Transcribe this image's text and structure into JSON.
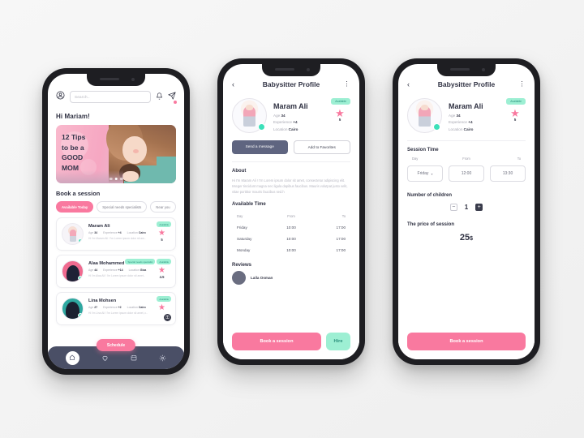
{
  "colors": {
    "pink": "#f9799f",
    "mint": "#9defd3",
    "navy": "#4a4f66",
    "bg": "#f4f4f4"
  },
  "home": {
    "search_placeholder": "Search..",
    "icons": {
      "profile": "profile-icon",
      "bell": "bell-icon",
      "send": "send-icon"
    },
    "greeting": "Hi Mariam!",
    "banner": {
      "line1": "12 Tips",
      "line2": "to be a",
      "line3": "GOOD",
      "line4": "MOM"
    },
    "section_title": "Book a session",
    "chips": [
      {
        "label": "Available Today",
        "active": true
      },
      {
        "label": "Special needs specialists",
        "active": false
      },
      {
        "label": "Near you",
        "active": false
      }
    ],
    "cards": [
      {
        "name": "Maram Ali",
        "age_label": "Age",
        "age": "34",
        "exp_label": "Experience",
        "exp": "+4",
        "loc_label": "Location",
        "loc": "Cairo",
        "bio": "Hi I'm Maram Ali ! I'm Lorem ipsum dolor sit am..",
        "rating": "5",
        "badges": [
          "Available"
        ]
      },
      {
        "name": "Alaa Mohammed",
        "age_label": "Age",
        "age": "44",
        "exp_label": "Experience",
        "exp": "+14",
        "loc_label": "Location",
        "loc": "Giza",
        "bio": "Hi I'm Alaa Ali ! I'm Lorem ipsum dolor sit amet..",
        "rating": "4.5",
        "badges": [
          "Special needs specialist",
          "Available"
        ]
      },
      {
        "name": "Lina Mohsen",
        "age_label": "Age",
        "age": "27",
        "exp_label": "Experience",
        "exp": "+2",
        "loc_label": "Location",
        "loc": "Cairo",
        "bio": "Hi I'm Lina Ali ! I'm Lorem ipsum dolor sit amet, c..",
        "rating": "",
        "badges": [
          "Available"
        ],
        "locked": "⚿"
      }
    ],
    "schedule_label": "Schedule",
    "nav": [
      {
        "name": "home",
        "glyph": "⌂",
        "active": true
      },
      {
        "name": "favorites",
        "glyph": "♡",
        "active": false
      },
      {
        "name": "calendar",
        "glyph": "☷",
        "active": false
      },
      {
        "name": "settings",
        "glyph": "⚙",
        "active": false
      }
    ]
  },
  "profile": {
    "title": "Babysitter Profile",
    "sitter": {
      "name": "Maram Ali",
      "age_label": "Age",
      "age": "34",
      "exp_label": "Experience",
      "exp": "+4",
      "loc_label": "Location",
      "loc": "Cairo",
      "rating": "5",
      "badge": "Available"
    },
    "actions": {
      "message": "Send a message",
      "favorite": "Add to Favorites"
    },
    "about_title": "About",
    "about_text": "Hi I'm Maram Ali ! I'm Lorem ipsum dolor sit amet, consectetur adipiscing elit. Integer tincidunt magna nec ligula dapibus faucibus. Mauris volutpat justo velit, vitae porttitor mauris faucibus sed.h",
    "available_title": "Available  Time",
    "table_headers": {
      "day": "Day",
      "from": "From",
      "to": "To"
    },
    "table_rows": [
      {
        "day": "Friday",
        "from": "10:00",
        "to": "17:00"
      },
      {
        "day": "Saturday",
        "from": "10:00",
        "to": "17:00"
      },
      {
        "day": "Monday",
        "from": "10:00",
        "to": "17:00"
      }
    ],
    "reviews_title": "Reviews",
    "reviewer_name": "Laila Osman",
    "cta_book": "Book a session",
    "cta_hire": "Hire"
  },
  "booking": {
    "title": "Babysitter Profile",
    "sitter": {
      "name": "Maram Ali",
      "age_label": "Age",
      "age": "34",
      "exp_label": "Experience",
      "exp": "+4",
      "loc_label": "Location",
      "loc": "Cairo",
      "rating": "5",
      "badge": "Available"
    },
    "session_title": "Session Time",
    "labels": {
      "day": "Day",
      "from": "From",
      "to": "To"
    },
    "selected": {
      "day": "Friday",
      "from": "12:00",
      "to": "13:30"
    },
    "children_title": "Number of children",
    "children_count": "1",
    "minus": "−",
    "plus": "+",
    "price_title": "The price of session",
    "price_value": "25",
    "price_currency": "$",
    "cta_book": "Book a session"
  }
}
